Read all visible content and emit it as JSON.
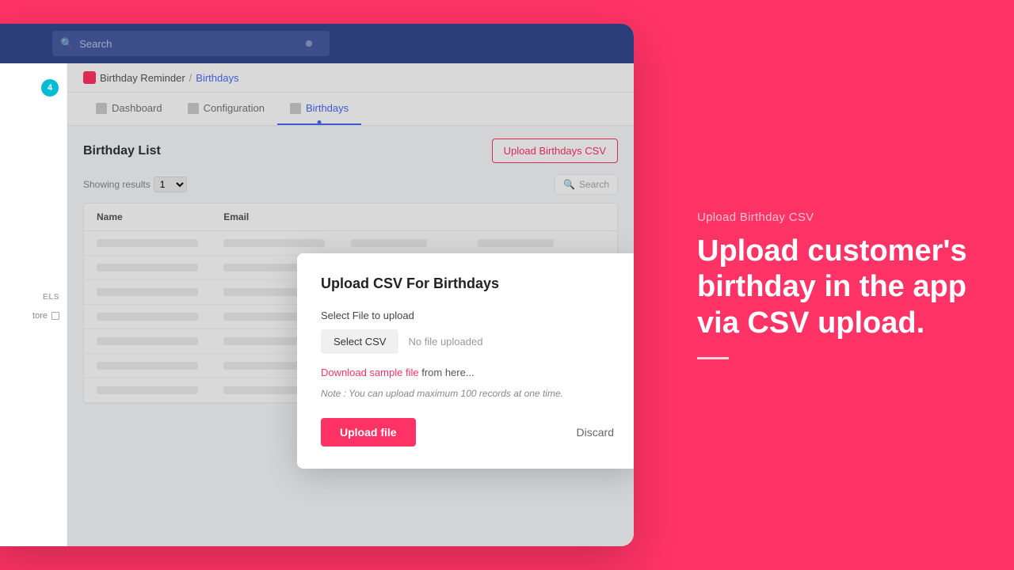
{
  "background_color": "#ff3366",
  "right_panel": {
    "subtitle": "Upload Birthday CSV",
    "title": "Upload customer's birthday in the app via CSV upload.",
    "divider": true
  },
  "topbar": {
    "search_placeholder": "Search"
  },
  "breadcrumb": {
    "app_name": "Birthday Reminder",
    "separator": "/",
    "current_page": "Birthdays"
  },
  "tabs": [
    {
      "label": "Dashboard",
      "active": false
    },
    {
      "label": "Configuration",
      "active": false
    },
    {
      "label": "Birthdays",
      "active": true
    }
  ],
  "birthday_list": {
    "title": "Birthday List",
    "upload_button": "Upload Birthdays CSV",
    "showing_label": "Showing results",
    "showing_value": "1",
    "search_placeholder": "Search"
  },
  "table": {
    "columns": [
      "Name",
      "Email",
      "",
      ""
    ],
    "rows": 7
  },
  "sidebar": {
    "badge_count": "4",
    "labels_title": "ELS",
    "store_label": "tore",
    "store_icon": "external-link"
  },
  "modal": {
    "title": "Upload CSV For Birthdays",
    "field_label": "Select File to upload",
    "select_csv_button": "Select CSV",
    "no_file_text": "No file uploaded",
    "download_link_text": "Download sample file",
    "download_suffix": "from here...",
    "note_text": "Note : You can upload maximum 100 records at one time.",
    "upload_button": "Upload file",
    "discard_button": "Discard"
  }
}
